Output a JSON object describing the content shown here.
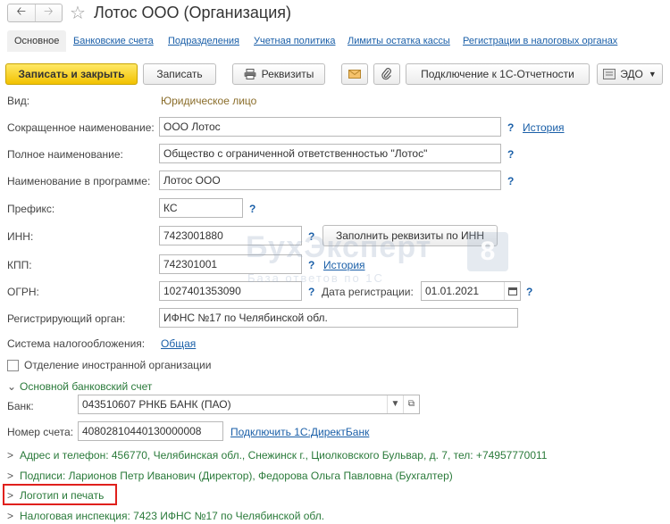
{
  "window": {
    "title": "Лотос ООО (Организация)"
  },
  "tabs": [
    {
      "label": "Основное"
    },
    {
      "label": "Банковские счета"
    },
    {
      "label": "Подразделения"
    },
    {
      "label": "Учетная политика"
    },
    {
      "label": "Лимиты остатка кассы"
    },
    {
      "label": "Регистрации в налоговых органах"
    }
  ],
  "toolbar": {
    "save_close": "Записать и закрыть",
    "save": "Записать",
    "requisites": "Реквизиты",
    "connect_1c": "Подключение к 1С-Отчетности",
    "edo": "ЭДО"
  },
  "form": {
    "vid_label": "Вид:",
    "vid_value": "Юридическое лицо",
    "short_name_label": "Сокращенное наименование:",
    "short_name_value": "ООО Лотос",
    "history_label": "История",
    "full_name_label": "Полное наименование:",
    "full_name_value": "Общество с ограниченной ответственностью \"Лотос\"",
    "program_name_label": "Наименование в программе:",
    "program_name_value": "Лотос ООО",
    "prefix_label": "Префикс:",
    "prefix_value": "КС",
    "inn_label": "ИНН:",
    "inn_value": "7423001880",
    "fill_by_inn": "Заполнить реквизиты по ИНН",
    "kpp_label": "КПП:",
    "kpp_value": "742301001",
    "kpp_history": "История",
    "ogrn_label": "ОГРН:",
    "ogrn_value": "1027401353090",
    "reg_date_label": "Дата регистрации:",
    "reg_date_value": "01.01.2021",
    "reg_organ_label": "Регистрирующий орган:",
    "reg_organ_value": "ИФНС №17 по Челябинской обл.",
    "tax_system_label": "Система налогообложения:",
    "tax_system_value": "Общая",
    "foreign_branch_label": "Отделение иностранной организации",
    "q_mark": "?"
  },
  "bank_section": {
    "header": "Основной банковский счет",
    "bank_label": "Банк:",
    "bank_value": "043510607 РНКБ БАНК (ПАО)",
    "account_label": "Номер счета:",
    "account_value": "40802810440130000008",
    "direct_bank_link": "Подключить 1С:ДиректБанк"
  },
  "collapsed": {
    "address": "Адрес и телефон: 456770, Челябинская обл., Снежинск г., Циолковского Бульвар, д. 7, тел: +74957770011",
    "signatures": "Подписи: Ларионов Петр Иванович (Директор), Федорова Ольга Павловна (Бухгалтер)",
    "logo": "Логотип и печать",
    "tax_inspection": "Налоговая инспекция: 7423 ИФНС №17 по Челябинской обл."
  },
  "watermark": {
    "brand": "БухЭксперт",
    "sub": "База ответов по 1С",
    "digit": "8"
  },
  "colors": {
    "accent": "#f2c200",
    "link": "#1a5fa8",
    "green": "#2a7a3a",
    "highlight": "#e0201c"
  }
}
